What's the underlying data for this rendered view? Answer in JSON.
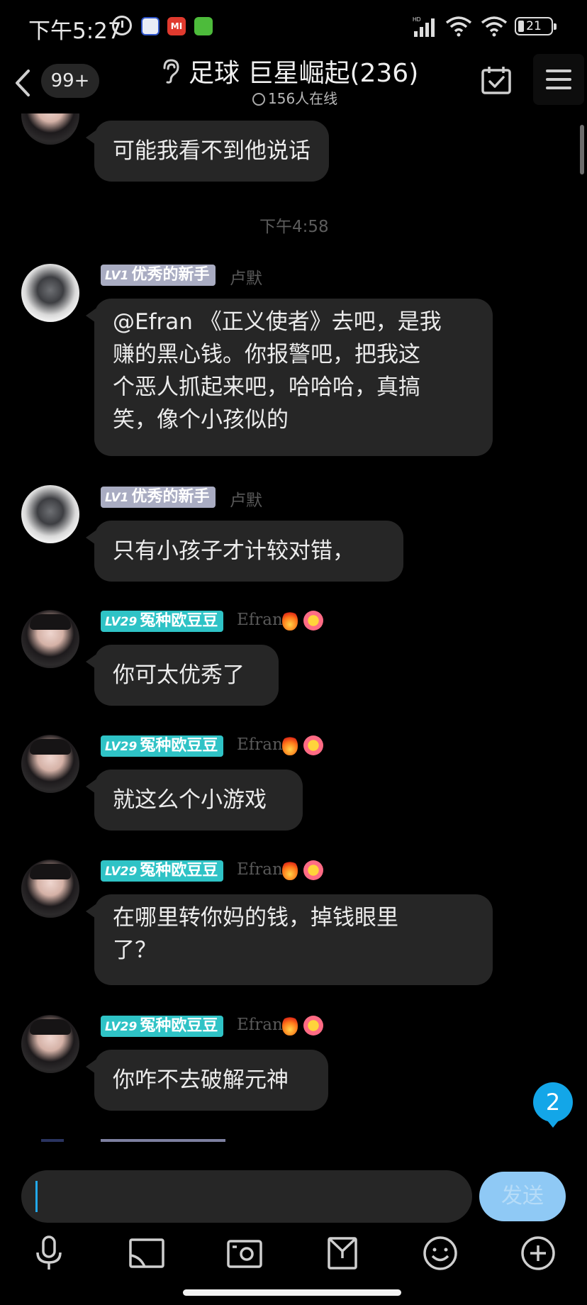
{
  "status_bar": {
    "time": "下午5:27",
    "app_icon_mi": "MI",
    "battery": "21"
  },
  "header": {
    "unread_count": "99+",
    "title": "足球 巨星崛起(236)",
    "online": "156人在线"
  },
  "chat": {
    "top_partial_message": "可能我看不到他说话",
    "timestamp": "下午4:58",
    "messages": [
      {
        "level": "LV1",
        "title": "优秀的新手",
        "nickname": "卢默",
        "lines": [
          "@Efran 《正义使者》去吧，是我",
          "赚的黑心钱。你报警吧，把我这",
          "个恶人抓起来吧，哈哈哈，真搞",
          "笑，像个小孩似的"
        ]
      },
      {
        "level": "LV1",
        "title": "优秀的新手",
        "nickname": "卢默",
        "lines": [
          "只有小孩子才计较对错，"
        ]
      },
      {
        "level": "LV29",
        "title": "冤种欧豆豆",
        "nickname": "Efran",
        "lines": [
          "你可太优秀了"
        ]
      },
      {
        "level": "LV29",
        "title": "冤种欧豆豆",
        "nickname": "Efran",
        "lines": [
          "就这么个小游戏"
        ]
      },
      {
        "level": "LV29",
        "title": "冤种欧豆豆",
        "nickname": "Efran",
        "lines": [
          "在哪里转你妈的钱，掉钱眼里",
          "了？"
        ]
      },
      {
        "level": "LV29",
        "title": "冤种欧豆豆",
        "nickname": "Efran",
        "lines": [
          "你咋不去破解元神"
        ]
      }
    ],
    "new_message_count": "2"
  },
  "composer": {
    "input_value": "",
    "send_label": "发送"
  },
  "toolbar_icons": [
    "microphone-icon",
    "image-icon",
    "camera-icon",
    "gift-bag-icon",
    "emoji-icon",
    "plus-icon"
  ],
  "colors": {
    "background": "#000000",
    "bubble": "#262626",
    "badge_lv1": "#a9acc2",
    "badge_lv29": "#2fc3c6",
    "accent": "#13a6e8",
    "send_button": "#8fc9f5"
  }
}
